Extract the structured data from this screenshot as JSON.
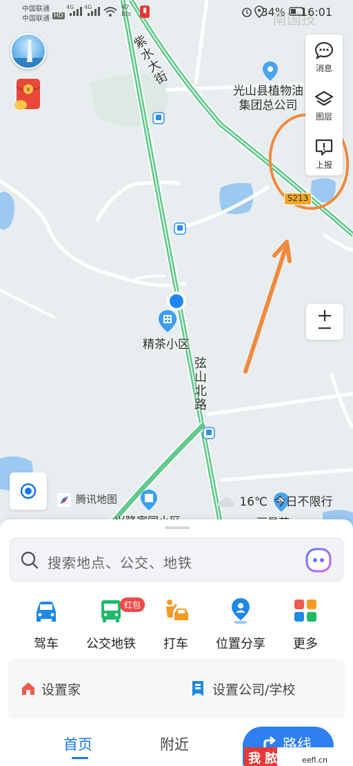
{
  "status_bar": {
    "carrier1": "中国联通",
    "carrier2": "中国联通",
    "hd": "HD",
    "net1": "4G",
    "net2": "4G",
    "speed": "47 B/s",
    "battery": "34%",
    "time": "16:01",
    "watermark": "南国技"
  },
  "map": {
    "street_main": "紫水大街",
    "road_north": "弦山北路",
    "poi_company": "光山县植物油集团总公司",
    "poi_company_line1": "光山县植物油",
    "poi_company_line2": "集团总公司",
    "poi_community": "精茶小区",
    "poi_bottom": "兴隆家园小区",
    "poi_bottom2": "丽景苑",
    "highway": "S213",
    "brand": "腾讯地图",
    "temperature": "16℃",
    "restriction": "今日不限行"
  },
  "side_panel": {
    "messages": "消息",
    "layers": "图层",
    "report": "上报"
  },
  "search": {
    "placeholder": "搜索地点、公交、地铁"
  },
  "shortcuts": [
    {
      "label": "驾车",
      "icon": "car-icon",
      "color": "#1e88e5"
    },
    {
      "label": "公交地铁",
      "icon": "bus-icon",
      "color": "#20b96a",
      "badge": "红包"
    },
    {
      "label": "打车",
      "icon": "taxi-icon",
      "color": "#f59a23"
    },
    {
      "label": "位置分享",
      "icon": "location-share-icon",
      "color": "#1e88e5"
    },
    {
      "label": "更多",
      "icon": "more-icon",
      "color": "#f05a50"
    }
  ],
  "home_row": {
    "home": "设置家",
    "company": "设置公司/学校"
  },
  "nav": {
    "home": "首页",
    "nearby": "附近",
    "route": "路线"
  },
  "overlay": {
    "eefl_text": "eefl.cn",
    "eefl_brand": "我 脓了"
  }
}
